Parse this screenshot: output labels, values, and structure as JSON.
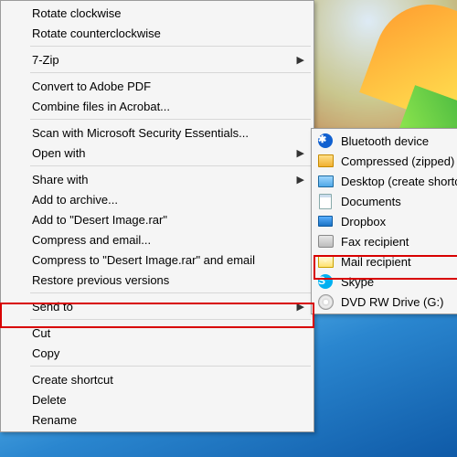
{
  "main_menu": {
    "groups": [
      [
        {
          "label": "Rotate clockwise",
          "submenu": false
        },
        {
          "label": "Rotate counterclockwise",
          "submenu": false
        }
      ],
      [
        {
          "label": "7-Zip",
          "submenu": true
        }
      ],
      [
        {
          "label": "Convert to Adobe PDF",
          "submenu": false
        },
        {
          "label": "Combine files in Acrobat...",
          "submenu": false
        }
      ],
      [
        {
          "label": "Scan with Microsoft Security Essentials...",
          "submenu": false
        },
        {
          "label": "Open with",
          "submenu": true
        }
      ],
      [
        {
          "label": "Share with",
          "submenu": true
        },
        {
          "label": "Add to archive...",
          "submenu": false
        },
        {
          "label": "Add to \"Desert Image.rar\"",
          "submenu": false
        },
        {
          "label": "Compress and email...",
          "submenu": false
        },
        {
          "label": "Compress to \"Desert Image.rar\" and email",
          "submenu": false
        },
        {
          "label": "Restore previous versions",
          "submenu": false
        }
      ],
      [
        {
          "label": "Send to",
          "submenu": true,
          "highlight": true
        }
      ],
      [
        {
          "label": "Cut",
          "submenu": false
        },
        {
          "label": "Copy",
          "submenu": false
        }
      ],
      [
        {
          "label": "Create shortcut",
          "submenu": false
        },
        {
          "label": "Delete",
          "submenu": false
        },
        {
          "label": "Rename",
          "submenu": false
        }
      ]
    ]
  },
  "sub_menu": {
    "items": [
      {
        "label": "Bluetooth device",
        "icon": "bluetooth"
      },
      {
        "label": "Compressed (zipped) folder",
        "icon": "folder"
      },
      {
        "label": "Desktop (create shortcut)",
        "icon": "monitor"
      },
      {
        "label": "Documents",
        "icon": "doc"
      },
      {
        "label": "Dropbox",
        "icon": "box"
      },
      {
        "label": "Fax recipient",
        "icon": "fax"
      },
      {
        "label": "Mail recipient",
        "icon": "mail",
        "highlight": true
      },
      {
        "label": "Skype",
        "icon": "skype"
      },
      {
        "label": "DVD RW Drive (G:)",
        "icon": "disc"
      }
    ]
  },
  "highlight_color": "#d80000"
}
